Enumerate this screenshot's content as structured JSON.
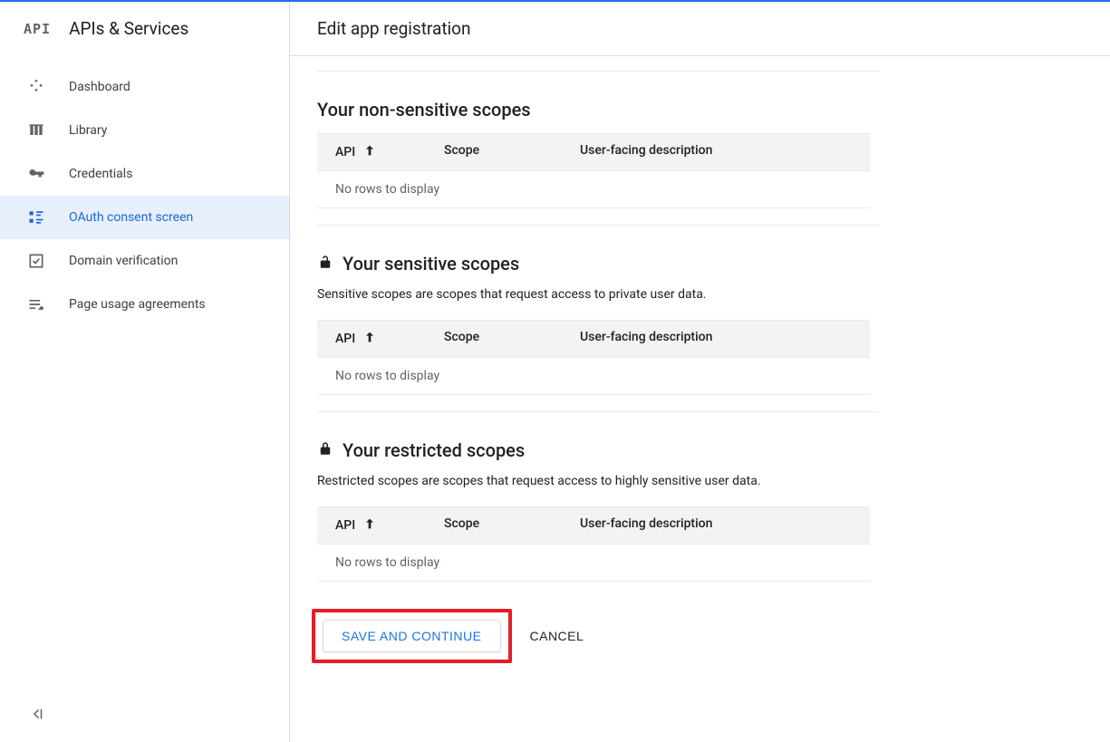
{
  "sidebar": {
    "icon_label": "API",
    "title": "APIs & Services",
    "items": [
      {
        "label": "Dashboard",
        "icon": "dashboard"
      },
      {
        "label": "Library",
        "icon": "library"
      },
      {
        "label": "Credentials",
        "icon": "key"
      },
      {
        "label": "OAuth consent screen",
        "icon": "consent"
      },
      {
        "label": "Domain verification",
        "icon": "checkbox"
      },
      {
        "label": "Page usage agreements",
        "icon": "agreement"
      }
    ]
  },
  "main": {
    "title": "Edit app registration",
    "sections": {
      "nonsensitive": {
        "title": "Your non-sensitive scopes",
        "table": {
          "col_api": "API",
          "col_scope": "Scope",
          "col_desc": "User-facing description",
          "empty": "No rows to display"
        }
      },
      "sensitive": {
        "title": "Your sensitive scopes",
        "desc": "Sensitive scopes are scopes that request access to private user data.",
        "table": {
          "col_api": "API",
          "col_scope": "Scope",
          "col_desc": "User-facing description",
          "empty": "No rows to display"
        }
      },
      "restricted": {
        "title": "Your restricted scopes",
        "desc": "Restricted scopes are scopes that request access to highly sensitive user data.",
        "table": {
          "col_api": "API",
          "col_scope": "Scope",
          "col_desc": "User-facing description",
          "empty": "No rows to display"
        }
      }
    },
    "buttons": {
      "save": "SAVE AND CONTINUE",
      "cancel": "CANCEL"
    }
  }
}
